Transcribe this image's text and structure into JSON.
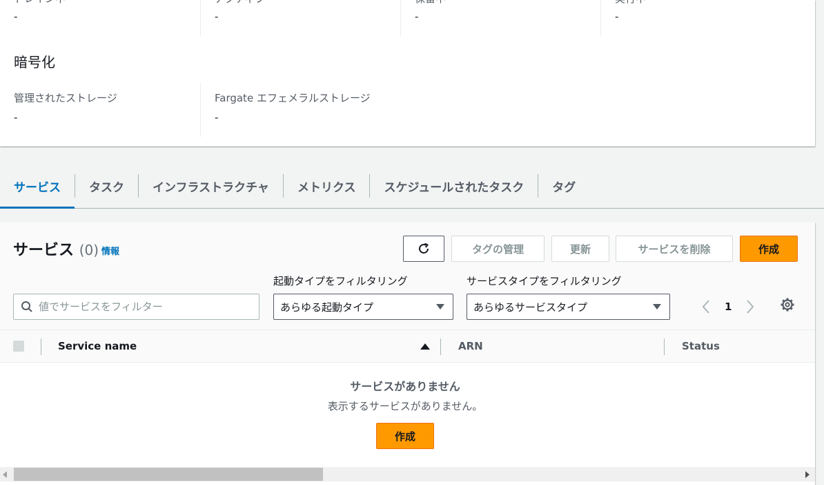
{
  "details_top_row": [
    {
      "label": "ドレイン中",
      "value": "-"
    },
    {
      "label": "アクティブ",
      "value": "-"
    },
    {
      "label": "保留中",
      "value": "-"
    },
    {
      "label": "実行中",
      "value": "-"
    }
  ],
  "encryption": {
    "heading": "暗号化",
    "items": [
      {
        "label": "管理されたストレージ",
        "value": "-"
      },
      {
        "label": "Fargate エフェメラルストレージ",
        "value": "-"
      }
    ]
  },
  "tabs": [
    {
      "label": "サービス"
    },
    {
      "label": "タスク"
    },
    {
      "label": "インフラストラクチャ"
    },
    {
      "label": "メトリクス"
    },
    {
      "label": "スケジュールされたタスク"
    },
    {
      "label": "タグ"
    }
  ],
  "services": {
    "title": "サービス",
    "count": "(0)",
    "info_link": "情報",
    "buttons": {
      "manage_tags": "タグの管理",
      "update": "更新",
      "delete": "サービスを削除",
      "create": "作成"
    },
    "filters": {
      "search_placeholder": "値でサービスをフィルター",
      "launch_type_label": "起動タイプをフィルタリング",
      "launch_type_value": "あらゆる起動タイプ",
      "service_type_label": "サービスタイプをフィルタリング",
      "service_type_value": "あらゆるサービスタイプ"
    },
    "pagination": {
      "current_page": "1"
    },
    "columns": [
      "Service name",
      "ARN",
      "Status"
    ],
    "empty": {
      "title": "サービスがありません",
      "description": "表示するサービスがありません。",
      "create_label": "作成"
    }
  },
  "colors": {
    "accent": "#0073bb",
    "primary_button": "#ff9900"
  }
}
